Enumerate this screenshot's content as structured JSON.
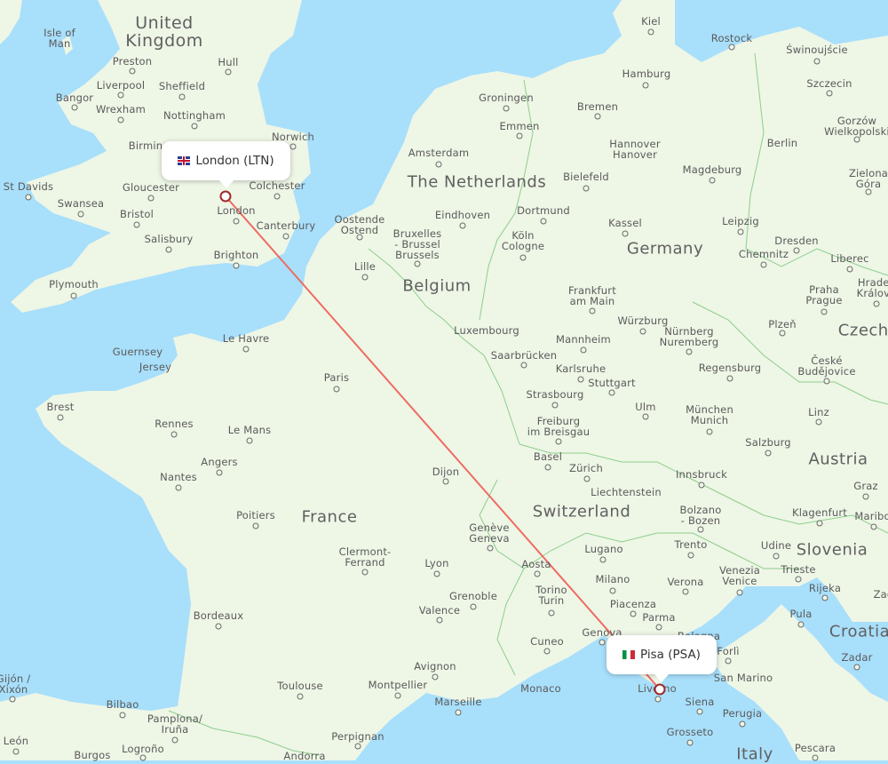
{
  "map": {
    "colors": {
      "water": "#a8dffb",
      "land": "#eef6e6",
      "route": "#ef6b62",
      "marker": "#9b2c2c",
      "border": "#8ccf8c"
    },
    "route": {
      "origin": {
        "label": "London (LTN)",
        "flag": "gb"
      },
      "destination": {
        "label": "Pisa (PSA)",
        "flag": "it"
      }
    },
    "countries": [
      {
        "name": "United\nKingdom"
      },
      {
        "name": "The Netherlands"
      },
      {
        "name": "Belgium"
      },
      {
        "name": "Germany"
      },
      {
        "name": "France"
      },
      {
        "name": "Switzerland"
      },
      {
        "name": "Austria"
      },
      {
        "name": "Slovenia"
      },
      {
        "name": "Croatia"
      },
      {
        "name": "Italy"
      },
      {
        "name": "Czechi"
      },
      {
        "name": "Luxembourg"
      },
      {
        "name": "Liechtenstein"
      },
      {
        "name": "Monaco"
      },
      {
        "name": "San Marino"
      },
      {
        "name": "Andorra"
      },
      {
        "name": "Isle of\nMan"
      },
      {
        "name": "Guernsey"
      },
      {
        "name": "Jersey"
      }
    ],
    "cities": [
      "Preston",
      "Hull",
      "Liverpool",
      "Sheffield",
      "Bangor",
      "Wrexham",
      "Nottingham",
      "Birmin",
      "Norwich",
      "St Davids",
      "Gloucester",
      "Colchester",
      "Swansea",
      "Bristol",
      "London",
      "Canterbury",
      "Salisbury",
      "Brighton",
      "Plymouth",
      "Kiel",
      "Rostock",
      "Świnoujście",
      "Hamburg",
      "Szczecin",
      "Bremen",
      "Groningen",
      "Emmen",
      "Gorzów\nWielkopolski",
      "Amsterdam",
      "Hannover\nHanover",
      "Berlin",
      "Magdeburg",
      "Bielefeld",
      "Zielona\nGóra",
      "Oostende\nOstend",
      "Eindhoven",
      "Dortmund",
      "Kassel",
      "Leipzig",
      "Bruxelles\n- Brussel\nBrussels",
      "Köln\nCologne",
      "Dresden",
      "Lille",
      "Chemnitz",
      "Liberec",
      "Frankfurt\nam Main",
      "Praha\nPrague",
      "Hradec\nKrálové",
      "Würzburg",
      "Plzeň",
      "Nürnberg\nNuremberg",
      "Mannheim",
      "Saarbrücken",
      "Le Havre",
      "Karlsruhe",
      "Regensburg",
      "České\nBudějovice",
      "Paris",
      "Stuttgart",
      "Strasbourg",
      "Brest",
      "Ulm",
      "München\nMunich",
      "Linz",
      "Rennes",
      "Le Mans",
      "Freiburg\nim Breisgau",
      "Salzburg",
      "Angers",
      "Basel",
      "Zürich",
      "Nantes",
      "Dijon",
      "Innsbruck",
      "Graz",
      "Poitiers",
      "Bolzano\n- Bozen",
      "Klagenfurt",
      "Maribor",
      "Genève\nGeneva",
      "Trento",
      "Udine",
      "Lugano",
      "Clermont-\nFerrand",
      "Aosta",
      "Lyon",
      "Trieste",
      "Venezia\nVenice",
      "Milano",
      "Verona",
      "Rijeka",
      "Torino\nTurin",
      "Piacenza",
      "Grenoble",
      "Valence",
      "Parma",
      "Pula",
      "Bordeaux",
      "Croatia",
      "Genova",
      "Bologna",
      "Cuneo",
      "Forlì",
      "Zadar",
      "Avignon",
      "Livorno",
      "San Marino",
      "Gijón /\nXixón",
      "Toulouse",
      "Montpellier",
      "Monaco",
      "Marseille",
      "Siena",
      "Bilbao",
      "Pamplona/\nIruña",
      "Perugia",
      "León",
      "Logroño",
      "Perpignan",
      "Grosseto",
      "Pescara",
      "Burgos",
      "Andorra",
      "Italy",
      "Zag"
    ]
  }
}
